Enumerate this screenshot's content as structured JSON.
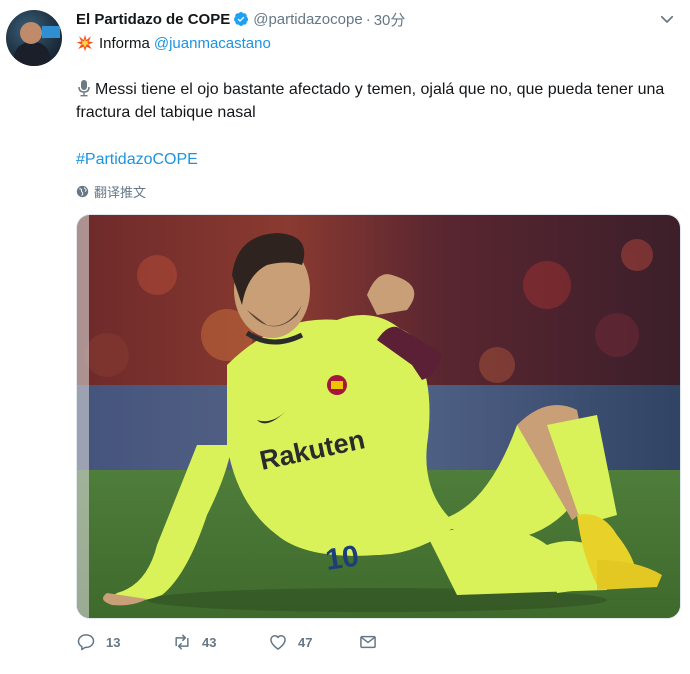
{
  "tweet": {
    "display_name": "El Partidazo de COPE",
    "handle": "@partidazocope",
    "separator": "·",
    "time": "30分",
    "informa_label": "Informa",
    "mention": "@juanmacastano",
    "body": "Messi tiene el ojo bastante afectado y temen, ojalá que no, que pueda tener una fractura del tabique nasal",
    "hashtag": "#PartidazoCOPE",
    "translate_label": "翻译推文",
    "photo_text": {
      "sponsor": "Rakuten",
      "shirt_number": "10"
    },
    "actions": {
      "reply_count": "13",
      "retweet_count": "43",
      "like_count": "47"
    }
  },
  "colors": {
    "link": "#1b95e0",
    "muted": "#657786",
    "verified": "#1da1f2",
    "kit": "#d9f25a"
  }
}
